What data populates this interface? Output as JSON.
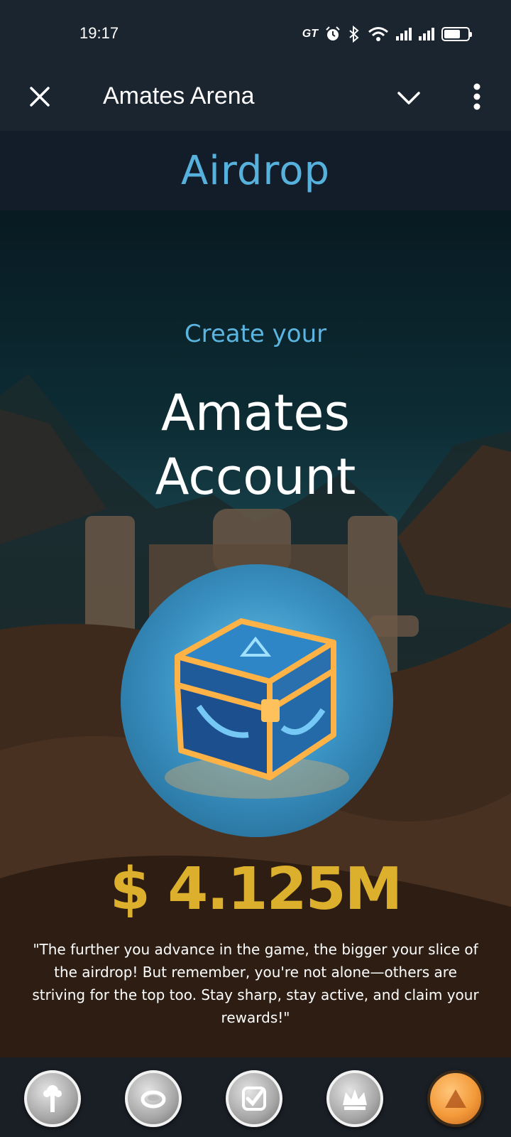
{
  "status_bar": {
    "time": "19:17",
    "carrier_tag": "GT",
    "icons": [
      "alarm-icon",
      "bluetooth-icon",
      "wifi-icon",
      "signal-icon",
      "signal-icon",
      "battery-icon"
    ]
  },
  "app_bar": {
    "title": "Amates Arena",
    "icons": [
      "close-icon",
      "chevron-down-icon",
      "more-vertical-icon"
    ]
  },
  "page": {
    "heading": "Airdrop"
  },
  "hero": {
    "subtitle": "Create your",
    "title_line1": "Amates",
    "title_line2": "Account",
    "amount": "$ 4.125M",
    "quote": "\"The further you advance in the game, the bigger your slice of the airdrop! But remember, you're not alone—others are striving for the top too. Stay sharp, stay active, and claim your rewards!\""
  },
  "bottom_nav": {
    "items": [
      {
        "icon": "tap-icon"
      },
      {
        "icon": "ring-icon"
      },
      {
        "icon": "tasks-check-icon"
      },
      {
        "icon": "crown-icon"
      },
      {
        "icon": "airdrop-coin-icon"
      }
    ]
  },
  "colors": {
    "heading_accent": "#56b1dc",
    "amount": "#dcb02c",
    "bar_bg": "#1b2530"
  }
}
